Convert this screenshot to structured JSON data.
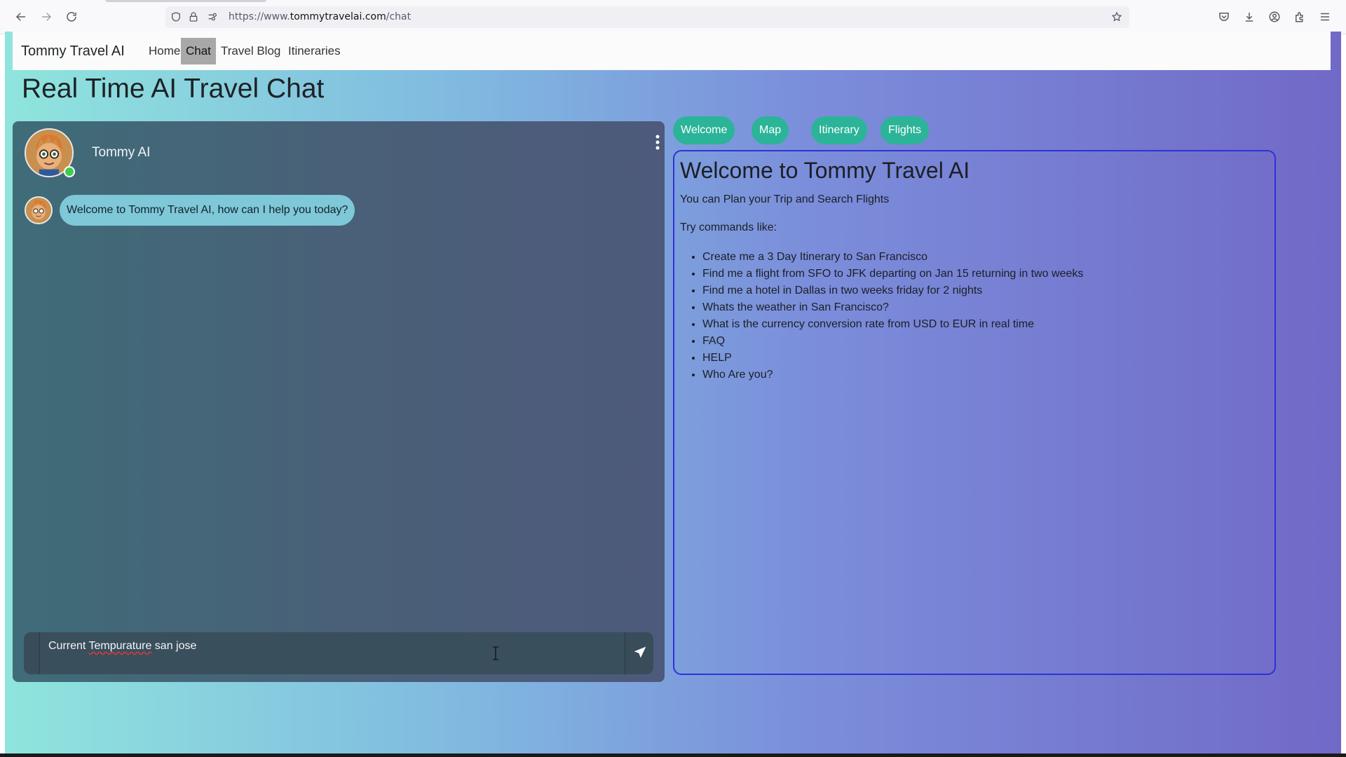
{
  "browser": {
    "url_prefix": "https://www.",
    "url_domain": "tommytravelai.com",
    "url_path": "/chat"
  },
  "navbar": {
    "brand": "Tommy Travel AI",
    "links": [
      {
        "label": "Home",
        "active": false
      },
      {
        "label": "Chat",
        "active": true
      },
      {
        "label": "Travel Blog",
        "active": false
      },
      {
        "label": "Itineraries",
        "active": false
      }
    ]
  },
  "page": {
    "title": "Real Time AI Travel Chat"
  },
  "chat": {
    "agent_name": "Tommy AI",
    "status": "online",
    "messages": [
      {
        "sender": "Tommy AI",
        "text": "Welcome to Tommy Travel AI, how can I help you today?"
      }
    ],
    "composer": {
      "value_word1": "Current",
      "value_word2": "Tempurature",
      "value_rest": "san jose"
    }
  },
  "tabs": [
    {
      "label": "Welcome"
    },
    {
      "label": "Map"
    },
    {
      "label": "Itinerary"
    },
    {
      "label": "Flights"
    }
  ],
  "welcome": {
    "title": "Welcome to Tommy Travel AI",
    "subtitle": "You can Plan your Trip and Search Flights",
    "try_label": "Try commands like:",
    "commands": [
      "Create me a 3 Day Itinerary to San Francisco",
      "Find me a flight from SFO to JFK departing on Jan 15 returning in two weeks",
      "Find me a hotel in Dallas in two weeks friday for 2 nights",
      "Whats the weather in San Francisco?",
      "What is the currency conversion rate from USD to EUR in real time",
      "FAQ",
      "HELP",
      "Who Are you?"
    ]
  },
  "colors": {
    "tab_pill": "#2bb497",
    "online_dot": "#3ecb4e",
    "panel_border": "#2d33d4",
    "bubble": "#7ec8d8"
  },
  "icons": [
    "back-icon",
    "forward-icon",
    "reload-icon",
    "shield-icon",
    "lock-icon",
    "permissions-icon",
    "bookmark-star-icon",
    "pocket-icon",
    "download-icon",
    "account-icon",
    "extensions-icon",
    "menu-icon",
    "kebab-menu-icon",
    "send-icon",
    "text-cursor-icon"
  ]
}
